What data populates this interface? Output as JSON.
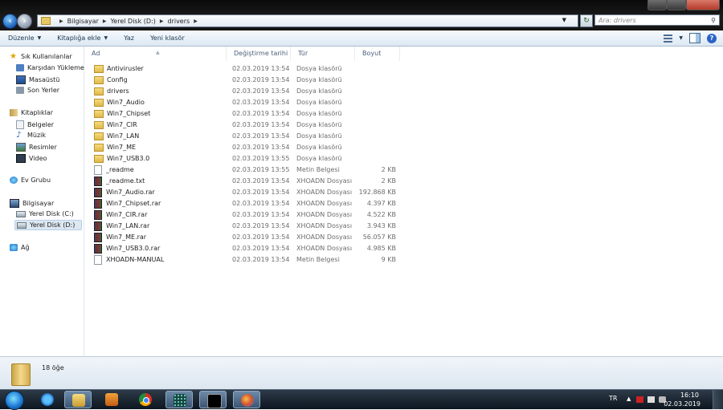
{
  "address": {
    "crumbs": [
      "Bilgisayar",
      "Yerel Disk (D:)",
      "drivers"
    ],
    "search_placeholder": "Ara: drivers"
  },
  "toolbar": {
    "organize": "Düzenle",
    "include_library": "Kitaplığa ekle",
    "share": "Yaz",
    "new_folder": "Yeni klasör"
  },
  "nav": {
    "favorites": "Sık Kullanılanlar",
    "downloads": "Karşıdan Yüklemeler",
    "desktop": "Masaüstü",
    "recent": "Son Yerler",
    "libraries": "Kitaplıklar",
    "documents": "Belgeler",
    "music": "Müzik",
    "pictures": "Resimler",
    "videos": "Video",
    "homegroup": "Ev Grubu",
    "computer": "Bilgisayar",
    "drive_c": "Yerel Disk (C:)",
    "drive_d": "Yerel Disk (D:)",
    "network": "Ağ"
  },
  "columns": {
    "name": "Ad",
    "date": "Değiştirme tarihi",
    "type": "Tür",
    "size": "Boyut"
  },
  "files": [
    {
      "name": "Antivirusler",
      "date": "02.03.2019 13:54",
      "type": "Dosya klasörü",
      "size": "",
      "kind": "folder"
    },
    {
      "name": "Config",
      "date": "02.03.2019 13:54",
      "type": "Dosya klasörü",
      "size": "",
      "kind": "folder"
    },
    {
      "name": "drivers",
      "date": "02.03.2019 13:54",
      "type": "Dosya klasörü",
      "size": "",
      "kind": "folder"
    },
    {
      "name": "Win7_Audio",
      "date": "02.03.2019 13:54",
      "type": "Dosya klasörü",
      "size": "",
      "kind": "folder"
    },
    {
      "name": "Win7_Chipset",
      "date": "02.03.2019 13:54",
      "type": "Dosya klasörü",
      "size": "",
      "kind": "folder"
    },
    {
      "name": "Win7_CIR",
      "date": "02.03.2019 13:54",
      "type": "Dosya klasörü",
      "size": "",
      "kind": "folder"
    },
    {
      "name": "Win7_LAN",
      "date": "02.03.2019 13:54",
      "type": "Dosya klasörü",
      "size": "",
      "kind": "folder"
    },
    {
      "name": "Win7_ME",
      "date": "02.03.2019 13:54",
      "type": "Dosya klasörü",
      "size": "",
      "kind": "folder"
    },
    {
      "name": "Win7_USB3.0",
      "date": "02.03.2019 13:55",
      "type": "Dosya klasörü",
      "size": "",
      "kind": "folder"
    },
    {
      "name": "_readme",
      "date": "02.03.2019 13:55",
      "type": "Metin Belgesi",
      "size": "2 KB",
      "kind": "txt"
    },
    {
      "name": "_readme.txt",
      "date": "02.03.2019 13:54",
      "type": "XHOADN Dosyası",
      "size": "2 KB",
      "kind": "rar"
    },
    {
      "name": "Win7_Audio.rar",
      "date": "02.03.2019 13:54",
      "type": "XHOADN Dosyası",
      "size": "192.868 KB",
      "kind": "rar"
    },
    {
      "name": "Win7_Chipset.rar",
      "date": "02.03.2019 13:54",
      "type": "XHOADN Dosyası",
      "size": "4.397 KB",
      "kind": "rar"
    },
    {
      "name": "Win7_CIR.rar",
      "date": "02.03.2019 13:54",
      "type": "XHOADN Dosyası",
      "size": "4.522 KB",
      "kind": "rar"
    },
    {
      "name": "Win7_LAN.rar",
      "date": "02.03.2019 13:54",
      "type": "XHOADN Dosyası",
      "size": "3.943 KB",
      "kind": "rar"
    },
    {
      "name": "Win7_ME.rar",
      "date": "02.03.2019 13:54",
      "type": "XHOADN Dosyası",
      "size": "56.057 KB",
      "kind": "rar"
    },
    {
      "name": "Win7_USB3.0.rar",
      "date": "02.03.2019 13:54",
      "type": "XHOADN Dosyası",
      "size": "4.985 KB",
      "kind": "rar"
    },
    {
      "name": "XHOADN-MANUAL",
      "date": "02.03.2019 13:54",
      "type": "Metin Belgesi",
      "size": "9 KB",
      "kind": "txt"
    }
  ],
  "status": {
    "item_count": "18 öğe"
  },
  "taskbar": {
    "language": "TR",
    "time": "16:10",
    "date": "02.03.2019"
  }
}
